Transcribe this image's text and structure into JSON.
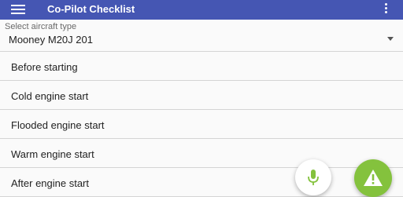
{
  "app": {
    "title": "Co-Pilot Checklist",
    "menu_icon": "hamburger-menu-icon",
    "overflow_icon": "more-vert-icon"
  },
  "aircraft_selector": {
    "label": "Select aircraft type",
    "value": "Mooney M20J 201",
    "arrow_icon": "dropdown-arrow-icon"
  },
  "checklists": [
    {
      "label": "Before starting"
    },
    {
      "label": "Cold engine start"
    },
    {
      "label": "Flooded engine start"
    },
    {
      "label": "Warm engine start"
    },
    {
      "label": "After engine start"
    }
  ],
  "fabs": {
    "mic_icon": "microphone-icon",
    "warning_icon": "warning-icon"
  },
  "colors": {
    "appbar": "#4556b3",
    "warning_fab": "#84c23d",
    "mic": "#84c23d"
  }
}
